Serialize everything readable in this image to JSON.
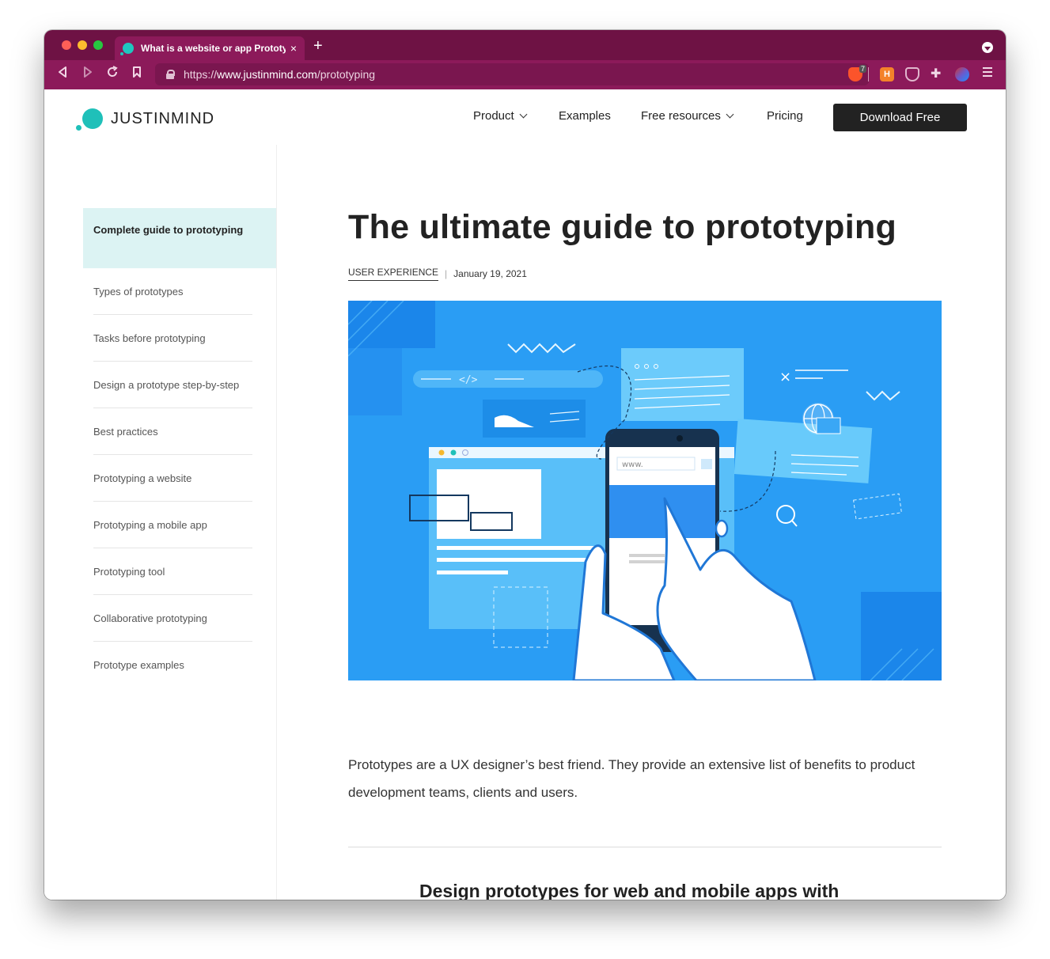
{
  "browser": {
    "tab_title": "What is a website or app Prototyping",
    "tab_close": "×",
    "new_tab": "+",
    "url_scheme": "https://",
    "url_host": "www.justinmind.com",
    "url_path": "/prototyping",
    "brave_badge": "7",
    "ext_h_label": "H",
    "accent": "#8c1a5a"
  },
  "header": {
    "logo_text": "JUSTINMIND",
    "nav": {
      "product": "Product",
      "examples": "Examples",
      "free_resources": "Free resources",
      "pricing": "Pricing"
    },
    "cta": "Download Free",
    "brand_color": "#1fc0b9"
  },
  "sidebar": {
    "active": "Complete guide to prototyping",
    "items": [
      "Types of prototypes",
      "Tasks before prototyping",
      "Design a prototype step-by-step",
      "Best practices",
      "Prototyping a website",
      "Prototyping a mobile app",
      "Prototyping tool",
      "Collaborative prototyping",
      "Prototype examples"
    ]
  },
  "article": {
    "title": "The ultimate guide to prototyping",
    "category": "USER EXPERIENCE",
    "separator": "|",
    "date": "January 19, 2021",
    "hero_url_text": "www.",
    "intro": "Prototypes are a UX designer’s best friend. They provide an extensive list of benefits to product development teams, clients and users.",
    "next_heading": "Design prototypes for web and mobile apps with"
  }
}
